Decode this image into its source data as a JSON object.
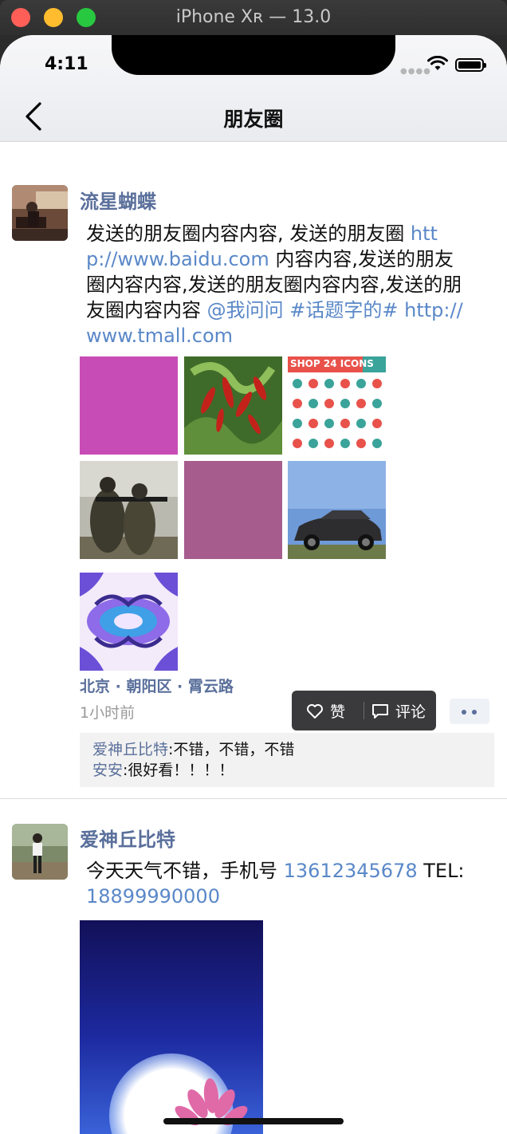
{
  "window": {
    "title": "iPhone Xʀ — 13.0"
  },
  "status_bar": {
    "time": "4:11"
  },
  "nav": {
    "title": "朋友圈"
  },
  "posts": [
    {
      "username": "流星蝴蝶",
      "content_parts": [
        {
          "text": "发送的朋友圈内容内容, 发送的朋友圈 ",
          "link": false
        },
        {
          "text": "http://www.baidu.com",
          "link": true
        },
        {
          "text": " 内容内容,发送的朋友圈内容内容,发送的朋友圈内容内容,发送的朋友圈内容内容 ",
          "link": false
        },
        {
          "text": "@我问问",
          "link": true
        },
        {
          "text": " ",
          "link": false
        },
        {
          "text": "#话题字的#",
          "link": true
        },
        {
          "text": " ",
          "link": false
        },
        {
          "text": "http://www.tmall.com",
          "link": true
        }
      ],
      "images": [
        "magenta-square",
        "red-chili-peppers-photo",
        "shop-24-icons-sheet",
        "soldiers-with-rifles-photo",
        "mauve-square",
        "black-car-photo",
        "purple-ornament-pattern"
      ],
      "image_text": {
        "shop_banner": "SHOP 24 ICONS"
      },
      "location": "北京 · 朝阳区 · 霄云路",
      "time_ago": "1小时前",
      "actions": {
        "like": "赞",
        "comment": "评论"
      },
      "comments": [
        {
          "name": "爱神丘比特",
          "text": "不错，不错，不错"
        },
        {
          "name": "安安",
          "text": "很好看！！！！"
        }
      ]
    },
    {
      "username": "爱神丘比特",
      "content_parts": [
        {
          "text": "今天天气不错，手机号 ",
          "link": false
        },
        {
          "text": "13612345678",
          "link": true
        },
        {
          "text": " TEL:",
          "link": false
        },
        {
          "text": "18899990000",
          "link": true
        }
      ],
      "images": [
        "moon-lotus-night-photo"
      ]
    }
  ],
  "colors": {
    "name_blue": "#5a6f9b",
    "link_blue": "#5a88c8",
    "popup_bg": "#3a3a3c"
  }
}
